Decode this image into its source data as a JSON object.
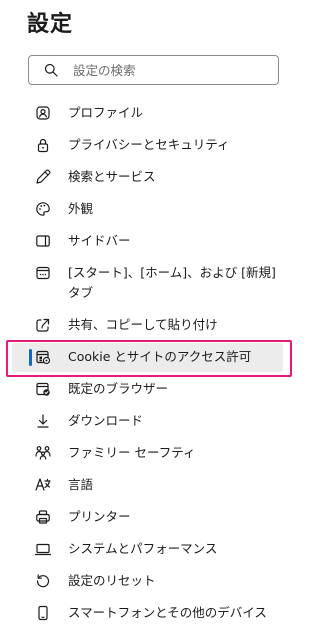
{
  "header": {
    "title": "設定"
  },
  "search": {
    "placeholder": "設定の検索",
    "value": ""
  },
  "colors": {
    "selected_accent": "#0f6cbd",
    "selected_background": "#ececec",
    "highlight_outline": "#e6197c"
  },
  "nav": {
    "items": [
      {
        "label": "プロファイル",
        "icon": "profile-icon"
      },
      {
        "label": "プライバシーとセキュリティ",
        "icon": "lock-icon"
      },
      {
        "label": "検索とサービス",
        "icon": "pen-icon"
      },
      {
        "label": "外観",
        "icon": "palette-icon"
      },
      {
        "label": "サイドバー",
        "icon": "sidebar-icon"
      },
      {
        "label": "[スタート]、[ホーム]、および [新規] タブ",
        "icon": "new-tab-icon"
      },
      {
        "label": "共有、コピーして貼り付け",
        "icon": "share-icon"
      },
      {
        "label": "Cookie とサイトのアクセス許可",
        "icon": "site-permissions-icon",
        "selected": true
      },
      {
        "label": "既定のブラウザー",
        "icon": "default-browser-icon"
      },
      {
        "label": "ダウンロード",
        "icon": "download-icon"
      },
      {
        "label": "ファミリー セーフティ",
        "icon": "family-icon"
      },
      {
        "label": "言語",
        "icon": "language-icon"
      },
      {
        "label": "プリンター",
        "icon": "printer-icon"
      },
      {
        "label": "システムとパフォーマンス",
        "icon": "laptop-icon"
      },
      {
        "label": "設定のリセット",
        "icon": "reset-icon"
      },
      {
        "label": "スマートフォンとその他のデバイス",
        "icon": "phone-icon"
      }
    ]
  }
}
